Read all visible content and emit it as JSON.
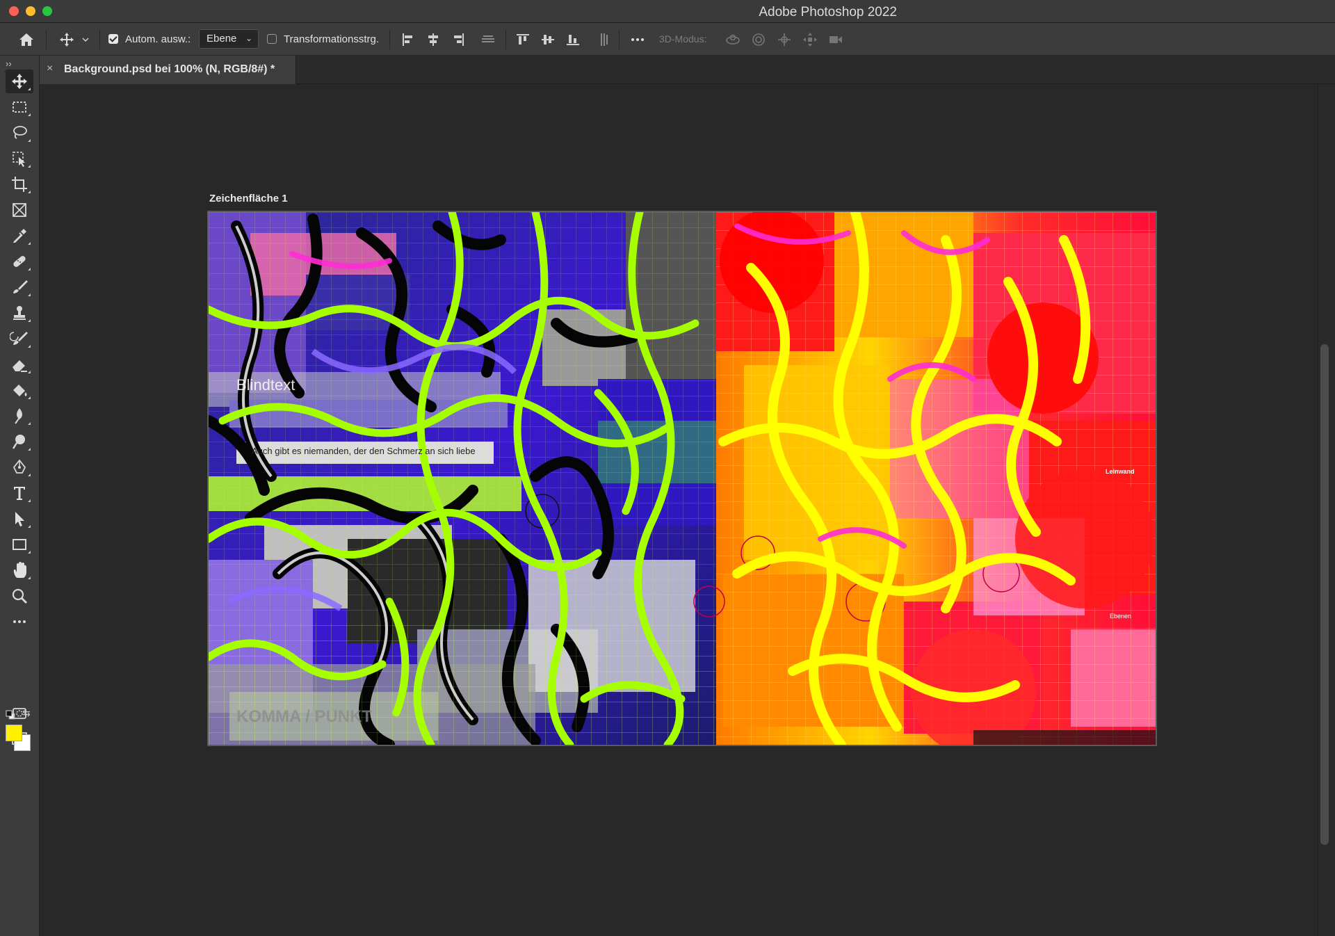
{
  "window": {
    "title": "Adobe Photoshop 2022",
    "controls": [
      "close",
      "minimize",
      "maximize"
    ]
  },
  "options_bar": {
    "home_icon": "home-icon",
    "move_tool_icon": "move-icon",
    "auto_select": {
      "label": "Autom. ausw.:",
      "checked": true
    },
    "auto_select_target": {
      "value": "Ebene"
    },
    "transform_controls": {
      "label": "Transformationsstrg.",
      "checked": false
    },
    "align_icons": [
      "align-left-edges-icon",
      "align-horizontal-centers-icon",
      "align-right-edges-icon",
      "distribute-horizontal-icon",
      "align-top-edges-icon",
      "align-vertical-centers-icon",
      "align-bottom-edges-icon",
      "distribute-vertical-icon"
    ],
    "more_icon": "more-options-icon",
    "mode_3d_label": "3D-Modus:",
    "mode_3d_icons": [
      "orbit-3d-icon",
      "roll-3d-icon",
      "pan-3d-icon",
      "slide-3d-icon",
      "scale-3d-icon"
    ]
  },
  "document_tab": {
    "close_glyph": "×",
    "title": "Background.psd bei 100% (N, RGB/8#) *"
  },
  "toolbar": {
    "collapse_glyph": "››",
    "tools": [
      "move-tool",
      "rectangular-marquee-tool",
      "lasso-tool",
      "object-selection-tool",
      "crop-tool",
      "frame-tool",
      "eyedropper-tool",
      "spot-healing-brush-tool",
      "brush-tool",
      "clone-stamp-tool",
      "history-brush-tool",
      "eraser-tool",
      "paint-bucket-tool",
      "blur-tool",
      "dodge-tool",
      "pen-tool",
      "type-tool",
      "path-selection-tool",
      "rectangle-tool",
      "hand-tool",
      "zoom-tool",
      "edit-toolbar"
    ],
    "active_tool": "move-tool",
    "foreground_color": "#ffef00",
    "background_color": "#ffffff",
    "bottom_icons": [
      "quick-mask-icon",
      "screen-mode-icon"
    ]
  },
  "artboard": {
    "label": "Zeichenfläche 1"
  },
  "canvas_text": {
    "blindtext": "Blindtext",
    "quote": "Auch gibt es niemanden, der den Schmerz an sich liebe",
    "komma": "KOMMA / PUNKT",
    "leinwand": "Leinwand",
    "ebenen": "Ebenen"
  },
  "colors": {
    "accent_yellow": "#ffef00",
    "neon_green": "#a6ff00",
    "red": "#ff1a1a",
    "blue": "#1a10c8",
    "magenta": "#ff2bd6"
  }
}
